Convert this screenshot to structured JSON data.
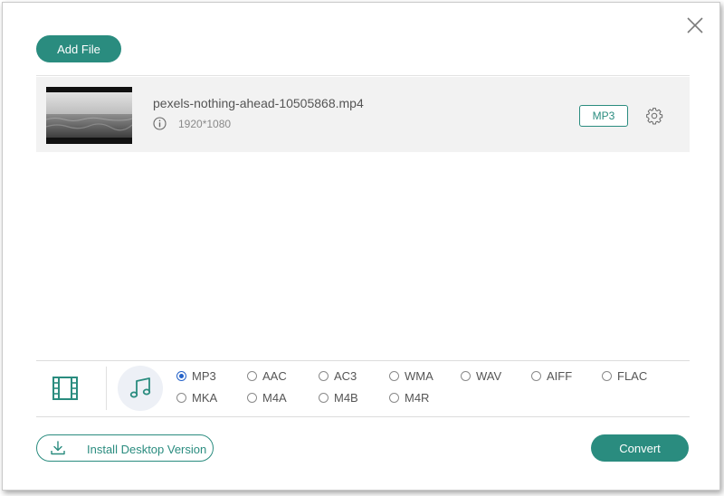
{
  "toolbar": {
    "add_file_label": "Add File"
  },
  "file": {
    "name": "pexels-nothing-ahead-10505868.mp4",
    "resolution": "1920*1080",
    "output_format": "MP3"
  },
  "format_tabs": {
    "video": "film-icon",
    "audio": "music-note-icon",
    "active": "audio"
  },
  "audio_formats": {
    "selected": "MP3",
    "row1": [
      "MP3",
      "AAC",
      "AC3",
      "WMA",
      "WAV",
      "AIFF",
      "FLAC"
    ],
    "row2": [
      "MKA",
      "M4A",
      "M4B",
      "M4R"
    ]
  },
  "footer": {
    "install_label": "Install Desktop Version",
    "convert_label": "Convert"
  },
  "colors": {
    "accent": "#2a8c7f",
    "radio_selected": "#2563c9",
    "row_bg": "#f2f2f2"
  }
}
